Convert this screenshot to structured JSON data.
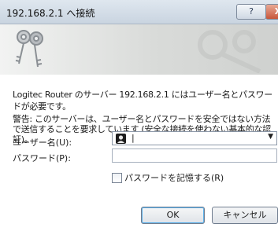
{
  "window": {
    "title": "192.168.2.1 へ接続",
    "help_label": "?",
    "close_label": "X"
  },
  "banner": {
    "icon": "keys-icon"
  },
  "dialog": {
    "description": "Logitec Router のサーバー 192.168.2.1 にはユーザー名とパスワードが必要です。",
    "warning": "警告: このサーバーは、ユーザー名とパスワードを安全ではない方法で送信することを要求しています (安全な接続を使わない基本的な認証)。"
  },
  "form": {
    "username_label": "ユーザー名(U):",
    "username_value": "|",
    "username_icon": "user-icon",
    "password_label": "パスワード(P):",
    "password_value": "",
    "remember_label": "パスワードを記憶する(R)",
    "remember_checked": false
  },
  "buttons": {
    "ok_label": "OK",
    "cancel_label": "キャンセル"
  },
  "colors": {
    "titlebar": "#c9d4e0",
    "close_button": "#c8563a",
    "focus_ring": "#5cb0e8"
  }
}
